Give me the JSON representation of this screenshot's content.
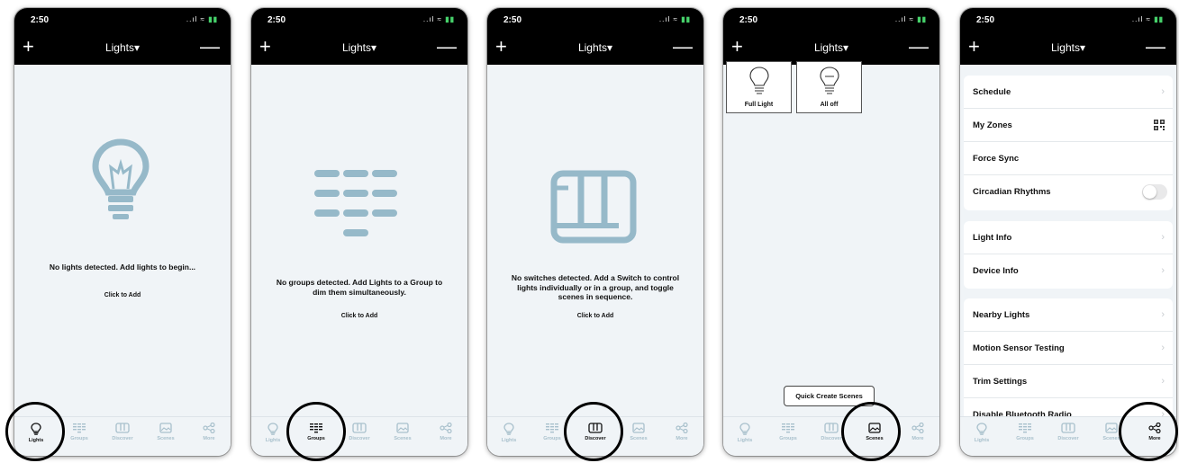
{
  "status": {
    "time": "2:50",
    "signal": "..ıl ≈"
  },
  "navbar": {
    "title": "Lights▾",
    "plus": "+",
    "minus": "—"
  },
  "tabs": [
    "Lights",
    "Groups",
    "Discover",
    "Scenes",
    "More"
  ],
  "screens": [
    {
      "active_tab": "Lights",
      "message": "No lights detected. Add lights to begin...",
      "action": "Click to Add"
    },
    {
      "active_tab": "Groups",
      "message": "No groups detected. Add Lights to a Group to dim them simultaneously.",
      "action": "Click to Add"
    },
    {
      "active_tab": "Discover",
      "message": "No switches detected. Add a Switch to control lights individually or in a group, and toggle scenes in sequence.",
      "action": "Click to Add"
    },
    {
      "active_tab": "Scenes",
      "scenes": [
        "Full Light",
        "All off"
      ],
      "quick_create": "Quick Create Scenes"
    },
    {
      "active_tab": "More",
      "groups": [
        [
          "Schedule",
          "My Zones",
          "Force Sync",
          "Circadian Rhythms"
        ],
        [
          "Light Info",
          "Device Info"
        ],
        [
          "Nearby Lights",
          "Motion Sensor Testing",
          "Trim Settings",
          "Disable Bluetooth Radio"
        ]
      ]
    }
  ],
  "colors": {
    "icon": "#96b9c9",
    "tab_inactive": "#a8c0cc",
    "bar": "#000000",
    "bg": "#f0f4f7"
  }
}
